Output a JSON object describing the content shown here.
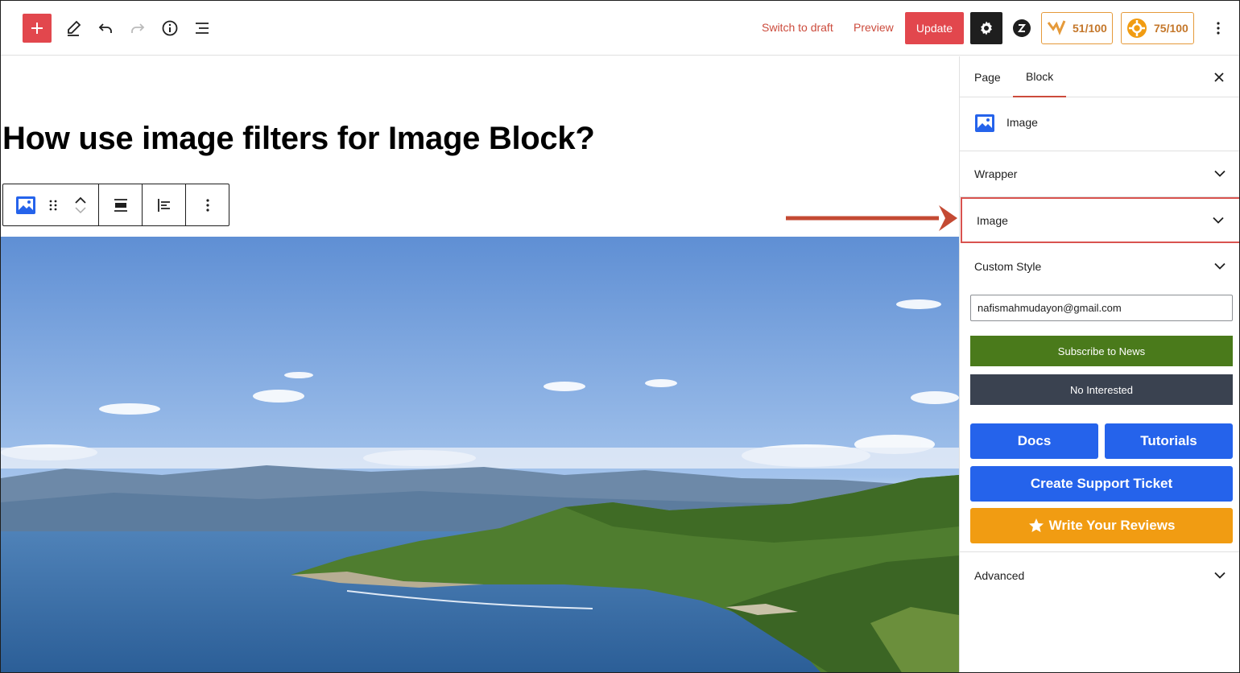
{
  "topbar": {
    "switch_to_draft": "Switch to draft",
    "preview": "Preview",
    "update": "Update",
    "seo_score": "51/100",
    "readability_score": "75/100"
  },
  "editor": {
    "post_title": "How use image filters for Image Block?"
  },
  "sidebar": {
    "tabs": [
      {
        "label": "Page",
        "active": false
      },
      {
        "label": "Block",
        "active": true
      }
    ],
    "block_name": "Image",
    "panels": {
      "wrapper": "Wrapper",
      "image": "Image",
      "custom_style": "Custom Style",
      "advanced": "Advanced"
    },
    "subscribe": {
      "email_value": "nafismahmudayon@gmail.com",
      "subscribe_label": "Subscribe to News",
      "not_interested_label": "No Interested"
    },
    "links": {
      "docs": "Docs",
      "tutorials": "Tutorials",
      "support": "Create Support Ticket",
      "reviews": "Write Your Reviews"
    }
  },
  "colors": {
    "accent_red": "#e2474d",
    "link_red": "#cc4b3c",
    "subscribe_green": "#4a7a1b",
    "dark_slate": "#3a4250",
    "primary_blue": "#2563eb",
    "review_orange": "#f19c12",
    "score_orange": "#e59a3a"
  }
}
